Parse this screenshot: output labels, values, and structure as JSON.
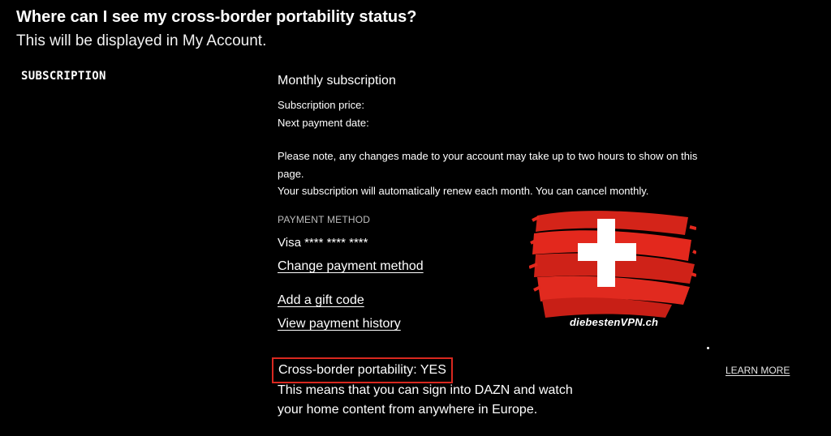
{
  "header": {
    "title": "Where can I see my cross-border portability status?",
    "subtitle": "This will be displayed in My Account."
  },
  "section": {
    "label": "SUBSCRIPTION"
  },
  "subscription": {
    "plan": "Monthly subscription",
    "price_label": "Subscription price:",
    "next_payment_label": "Next payment date:",
    "note_line1": "Please note, any changes made to your account may take up to two hours to show on this",
    "note_line2": "page.",
    "note_line3": "Your subscription will automatically renew each month. You can cancel monthly."
  },
  "payment": {
    "label": "PAYMENT METHOD",
    "card": "Visa **** **** ****",
    "change_link": "Change payment method",
    "gift_link": "Add a gift code",
    "history_link": "View payment history"
  },
  "portability": {
    "status": "Cross-border portability: YES",
    "learn_more": "LEARN MORE",
    "explain_line1": "This means that you can sign into DAZN and watch",
    "explain_line2": "your home content from anywhere in Europe.",
    "highlight_color": "#d9281f"
  },
  "watermark": {
    "brand": "diebestenVPN.ch",
    "flag": "swiss-flag-icon",
    "flag_color": "#e0251b"
  }
}
